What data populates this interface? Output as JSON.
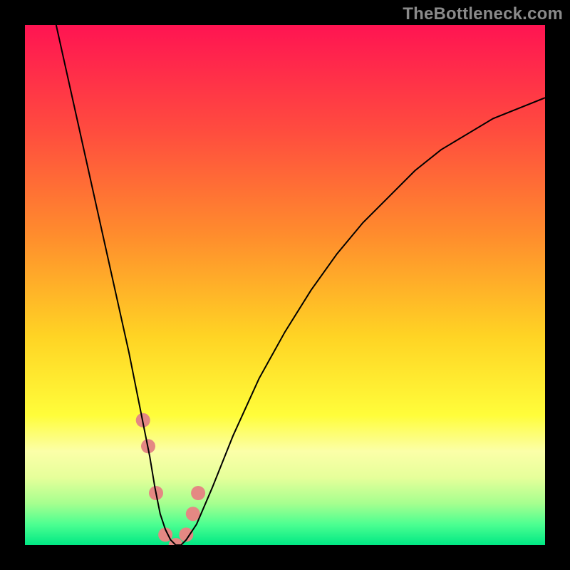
{
  "watermark": "TheBottleneck.com",
  "chart_data": {
    "type": "line",
    "title": "",
    "xlabel": "",
    "ylabel": "",
    "xlim": [
      0,
      100
    ],
    "ylim": [
      0,
      100
    ],
    "grid": false,
    "axes_visible": false,
    "background": {
      "type": "vertical-gradient",
      "stops": [
        {
          "pos": 0.0,
          "color": "#ff1452"
        },
        {
          "pos": 0.2,
          "color": "#ff4b3f"
        },
        {
          "pos": 0.4,
          "color": "#ff8b2d"
        },
        {
          "pos": 0.6,
          "color": "#ffd424"
        },
        {
          "pos": 0.75,
          "color": "#fffd3a"
        },
        {
          "pos": 0.82,
          "color": "#fbffa8"
        },
        {
          "pos": 0.87,
          "color": "#e6ff9a"
        },
        {
          "pos": 0.92,
          "color": "#a6ff8f"
        },
        {
          "pos": 0.96,
          "color": "#4dff91"
        },
        {
          "pos": 1.0,
          "color": "#00e884"
        }
      ]
    },
    "series": [
      {
        "name": "curve",
        "color": "#000000",
        "stroke_width": 2,
        "x": [
          6,
          8,
          10,
          12,
          14,
          16,
          18,
          20,
          22,
          23,
          24,
          25,
          26,
          27,
          28,
          29,
          30,
          31,
          33,
          36,
          40,
          45,
          50,
          55,
          60,
          65,
          70,
          75,
          80,
          85,
          90,
          95,
          100
        ],
        "y": [
          100,
          91,
          82,
          73,
          64,
          55,
          46,
          37,
          27,
          22,
          17,
          11,
          6,
          3,
          1,
          0,
          0,
          1,
          4,
          11,
          21,
          32,
          41,
          49,
          56,
          62,
          67,
          72,
          76,
          79,
          82,
          84,
          86
        ]
      },
      {
        "name": "highlight-markers",
        "type": "scatter",
        "color": "#e48883",
        "marker_radius": 10,
        "x": [
          22.7,
          23.7,
          25.2,
          27.0,
          29.0,
          31.0,
          32.3,
          33.3
        ],
        "y": [
          24,
          19,
          10,
          2,
          0,
          2,
          6,
          10
        ]
      }
    ]
  }
}
